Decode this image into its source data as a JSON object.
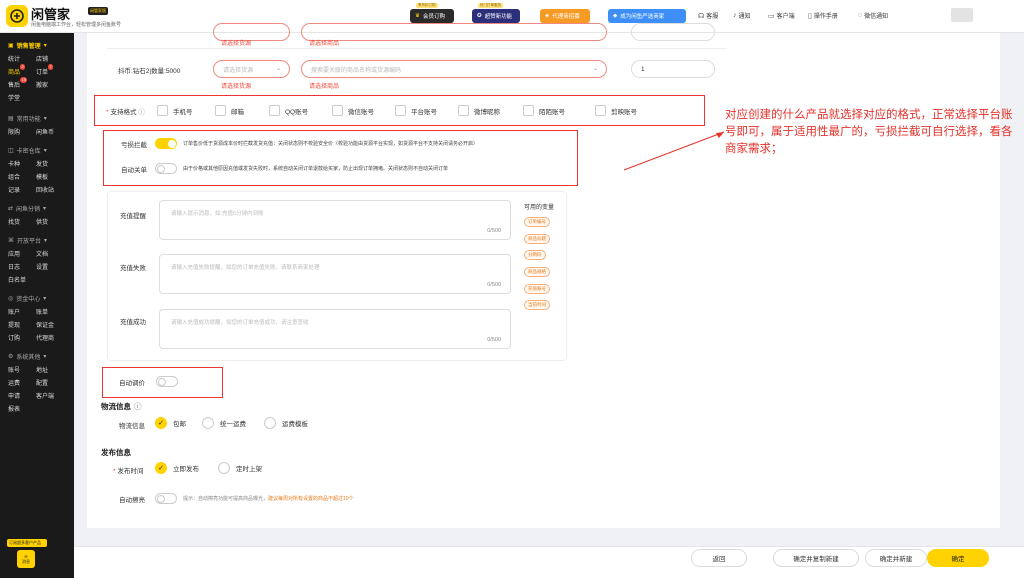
{
  "brand": {
    "name": "闲管家",
    "badge": "闲管家版",
    "tagline": "闲鱼电脑端工作台，轻松管理多闲鱼账号"
  },
  "topbar": {
    "promos": [
      {
        "tag": "享折扣订购",
        "label": "会员订购"
      },
      {
        "tag": "热门打单服务",
        "label": "超赞新功能"
      },
      {
        "tag": "",
        "label": "代理商招募"
      },
      {
        "tag": "",
        "label": "成为闲鱼严选商家"
      }
    ],
    "links": [
      "客服",
      "通知",
      "客户端",
      "操作手册",
      "微信通知"
    ]
  },
  "sidebar": {
    "groups": [
      {
        "title": "销售管理",
        "active": true,
        "rows": [
          [
            "统计",
            "店铺"
          ],
          [
            "商品",
            "订单"
          ],
          [
            "售后",
            "搬家"
          ],
          [
            "学堂"
          ]
        ]
      },
      {
        "title": "常用功能",
        "rows": [
          [
            "限购",
            "闲鱼币"
          ]
        ]
      },
      {
        "title": "卡密仓库",
        "rows": [
          [
            "卡种",
            "发货"
          ],
          [
            "组合",
            "模板"
          ],
          [
            "记录",
            "回收站"
          ]
        ]
      },
      {
        "title": "闲鱼分销",
        "rows": [
          [
            "找货",
            "供货"
          ]
        ]
      },
      {
        "title": "开放平台",
        "rows": [
          [
            "应用",
            "文档"
          ],
          [
            "日志",
            "设置"
          ],
          [
            "白名单"
          ]
        ]
      },
      {
        "title": "资金中心",
        "rows": [
          [
            "账户",
            "账单"
          ],
          [
            "提现",
            "保证金"
          ],
          [
            "订购",
            "代理商"
          ]
        ]
      },
      {
        "title": "系统其他",
        "rows": [
          [
            "账号",
            "地址"
          ],
          [
            "运费",
            "配置"
          ],
          [
            "申请",
            "客户端"
          ],
          [
            "报表"
          ]
        ]
      }
    ],
    "badges": {
      "goods": "2",
      "orders": "7",
      "aftersale": "19"
    },
    "bottom_tag": "订阅超多客户产品",
    "bottom_msg": "消息"
  },
  "form": {
    "row1": {
      "err_source": "请选择货源",
      "err_goods": "请选择商品"
    },
    "row2": {
      "label": "抖币:钻石2|数量:5000",
      "source_placeholder": "请选择货源",
      "goods_placeholder": "搜索要关联的商品名称或货源编码",
      "qty": "1",
      "err_source": "请选择货源",
      "err_goods": "请选择商品"
    },
    "support_format": {
      "label": "支持格式",
      "options": [
        "手机号",
        "邮箱",
        "QQ账号",
        "微信账号",
        "平台账号",
        "微博昵称",
        "陌陌账号",
        "剪映账号"
      ]
    },
    "loss_intercept": {
      "label": "亏损拦截",
      "on": true,
      "hint": "订单售价低于货源成本价时拦截发货充值：关闭状态则不校验安全价（校验功能由货源平台实现，如货源平台不支持关闭请务必开启）"
    },
    "auto_close": {
      "label": "自动关单",
      "on": false,
      "hint": "由于价格或其他原因充值或发货失败时，系统自动关闭订单退款给买家，防止出现订单拥堵。关闭状态则不自动关闭订单"
    },
    "remind": {
      "label": "充值提醒",
      "placeholder": "请输入提示消息，如:充值5分钟内到账",
      "count": "0/500"
    },
    "fail": {
      "label": "充值失败",
      "placeholder": "请输入充值失败提醒，如您的订单充值失败，请联系商家处理",
      "count": "0/500"
    },
    "success": {
      "label": "充值成功",
      "placeholder": "请输入充值成功提醒，如您的订单充值成功，请注意查收",
      "count": "0/500"
    },
    "variables": {
      "title": "可用的变量",
      "chips": [
        "订单编号",
        "商品标题",
        "分销码",
        "商品规格",
        "充值账号",
        "当前时间"
      ]
    },
    "auto_price": {
      "label": "自动调价",
      "on": false
    },
    "logistics": {
      "section": "物流信息",
      "label": "物流信息",
      "options": [
        "包邮",
        "统一运费",
        "运费模板"
      ],
      "selected": 0
    },
    "publish": {
      "section": "发布信息",
      "label": "发布时间",
      "options": [
        "立即发布",
        "定时上架"
      ],
      "selected": 0
    },
    "auto_polish": {
      "label": "自动擦亮",
      "hint_prefix": "提示：自动擦亮功能可提高商品曝光，",
      "hint_link": "建议每周对所有设置的商品不超过10个"
    }
  },
  "annotation": "对应创建的什么产品就选择对应的格式，正常选择平台账号即可，属于适用性最广的，亏损拦截可自行选择，看各商家需求；",
  "footer": {
    "buttons": [
      "返回",
      "确定并复制新建",
      "确定并新建",
      "确定"
    ]
  },
  "colors": {
    "accent": "#ffd200",
    "error": "#f04a3a",
    "annotation_red": "#e4322b"
  }
}
